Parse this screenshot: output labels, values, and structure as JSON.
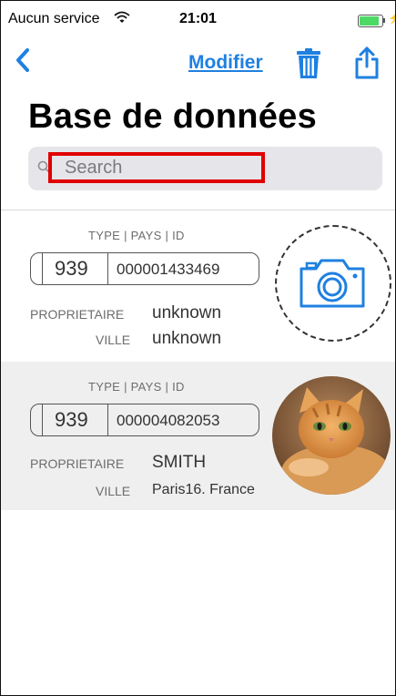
{
  "status_bar": {
    "carrier": "Aucun service",
    "time": "21:01",
    "battery_level": 0.8
  },
  "nav": {
    "edit_label": "Modifier"
  },
  "page": {
    "title": "Base de données"
  },
  "search": {
    "placeholder": "Search"
  },
  "records": [
    {
      "type_label": "TYPE | PAYS | ID",
      "country_code": "939",
      "id": "000001433469",
      "owner_label": "PROPRIETAIRE",
      "owner": "unknown",
      "city_label": "VILLE",
      "city": "unknown",
      "photo": "camera-placeholder"
    },
    {
      "type_label": "TYPE | PAYS | ID",
      "country_code": "939",
      "id": "000004082053",
      "owner_label": "PROPRIETAIRE",
      "owner": "SMITH",
      "city_label": "VILLE",
      "city": "Paris16. France",
      "photo": "kitten-photo"
    }
  ],
  "colors": {
    "accent": "#1f80e0",
    "highlight": "#e00000",
    "row_alt_bg": "#efefef"
  }
}
